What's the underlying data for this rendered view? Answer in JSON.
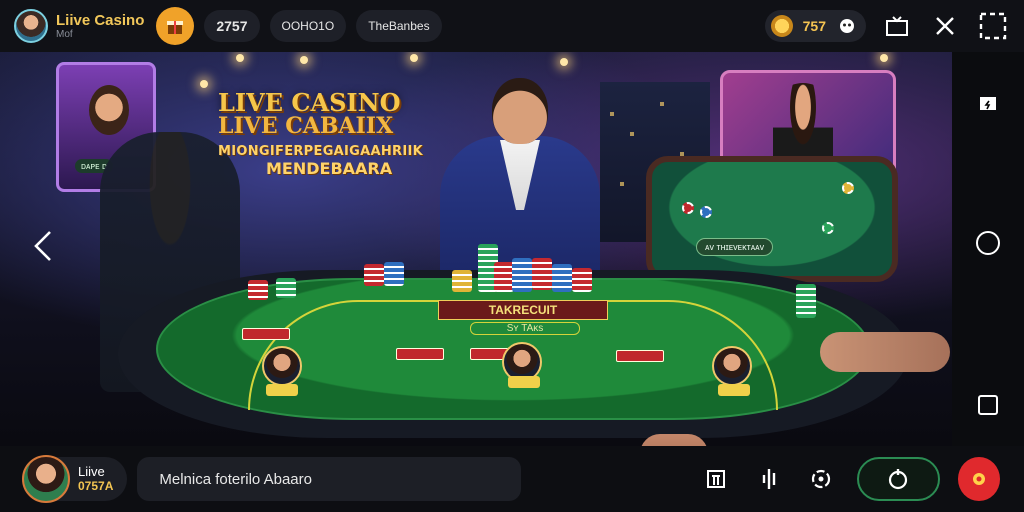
{
  "header": {
    "app_title": "Liive Casino",
    "app_subtitle": "Mof",
    "balance": "2757",
    "tab_1": "OOHO1O",
    "tab_2": "TheBanbes",
    "coins": "757"
  },
  "stage": {
    "title_line1": "LIVE CASINO",
    "title_line2": "LIVE CABAIIX",
    "title_line3": "MIONGIFERPEGAIGAAHRIIK",
    "title_line4": "MENDEBAARA",
    "left_screen_tag": "ᴅᴀᴘᴇ ᴅ",
    "table_label": "TAKRECUIT",
    "table_sublabel": "Sʏ TAᴋs",
    "mini_table_label": "ᴀᴠ ᴛʜɪᴇᴠᴇᴋᴛᴀᴀᴠ"
  },
  "footer": {
    "host_label": "Liive",
    "host_id": "0757A",
    "chat_text": "Melnica foterilo Abaaro"
  },
  "colors": {
    "accent_gold": "#f3c552",
    "accent_green": "#2b8c53",
    "accent_red": "#e0292d",
    "felt_green": "#1f8a3a"
  },
  "icons": [
    "avatar",
    "gift-icon",
    "coin-icon",
    "controller-icon",
    "tv-icon",
    "close-icon",
    "fullscreen-icon",
    "back-arrow-icon",
    "report-icon",
    "home-circle-icon",
    "square-icon",
    "menu-icon",
    "mic-icon",
    "camera-switch-icon",
    "refresh-icon",
    "record-icon"
  ]
}
